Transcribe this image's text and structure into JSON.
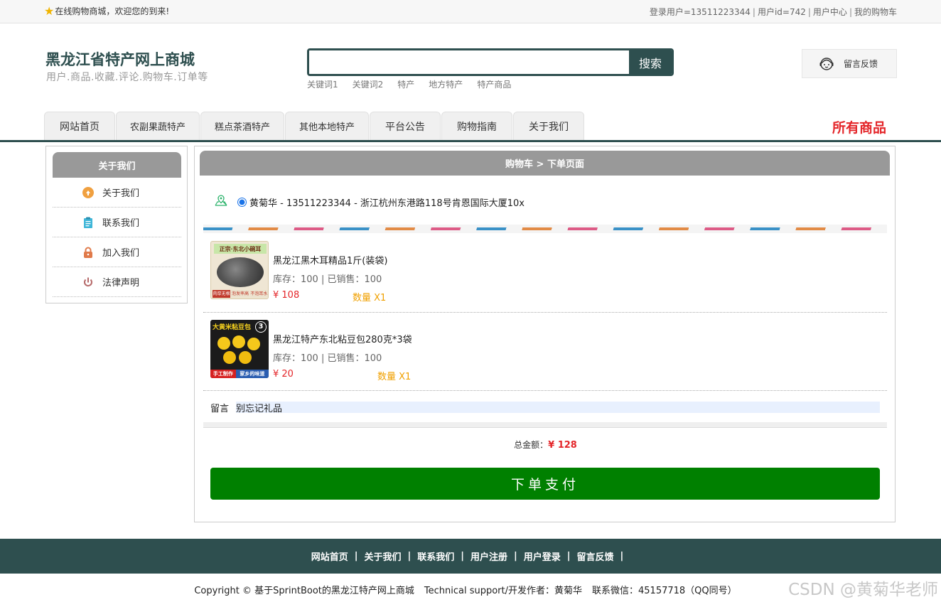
{
  "topbar": {
    "welcome": "在线购物商城，欢迎您的到来!",
    "login_user": "登录用户=13511223344",
    "user_id": "用户id=742",
    "user_center": "用户中心",
    "my_cart": "我的购物车"
  },
  "header": {
    "title": "黑龙江省特产网上商城",
    "subtitle": "用户.商品.收藏.评论.购物车.订单等",
    "search_button": "搜索",
    "search_value": "",
    "hotwords": [
      "关键词1",
      "关键词2",
      "特产",
      "地方特产",
      "特产商品"
    ],
    "feedback": "留言反馈"
  },
  "nav": {
    "tabs": [
      "网站首页",
      "农副果蔬特产",
      "糕点茶酒特产",
      "其他本地特产",
      "平台公告",
      "购物指南",
      "关于我们"
    ],
    "all_goods": "所有商品"
  },
  "sidebar": {
    "title": "关于我们",
    "items": [
      {
        "label": "关于我们",
        "icon": "about-icon",
        "color": "#f0a040"
      },
      {
        "label": "联系我们",
        "icon": "clipboard-icon",
        "color": "#3fb6d8"
      },
      {
        "label": "加入我们",
        "icon": "lock-icon",
        "color": "#e07a4a"
      },
      {
        "label": "法律声明",
        "icon": "power-icon",
        "color": "#b66a6a"
      }
    ]
  },
  "order": {
    "breadcrumb": "购物车 > 下单页面",
    "address": "黄菊华 - 13511223344 - 浙江杭州东港路118号肯恩国际大厦10x",
    "items": [
      {
        "name": "黑龙江黑木耳精品1斤(装袋)",
        "stock": "库存：100 | 已销售：100",
        "price": "¥ 108",
        "qty": "数量 X1",
        "thumb_banner": "正宗·东北小碗耳",
        "thumb_tags": [
          "肉厚无根",
          "泡发率高",
          "不泡耳水"
        ]
      },
      {
        "name": "黑龙江特产东北粘豆包280克*3袋",
        "stock": "库存：100 | 已销售：100",
        "price": "¥ 20",
        "qty": "数量 X1",
        "thumb_banner": "大黄米粘豆包",
        "thumb_badge": "3",
        "thumb_tags": [
          "手工制作",
          "家乡的味道"
        ]
      }
    ],
    "note_label": "留言",
    "note_value": "别忘记礼品",
    "total_label": "总金额：",
    "total_amount": "¥ 128",
    "pay_button": "下单支付"
  },
  "footer": {
    "links": [
      "网站首页",
      "关于我们",
      "联系我们",
      "用户注册",
      "用户登录",
      "留言反馈"
    ],
    "copyright": "Copyright © 基于SprintBoot的黑龙江特产网上商城",
    "support": "Technical support/开发作者：黄菊华",
    "contact": "联系微信：45157718（QQ同号）",
    "watermark": "CSDN @黄菊华老师"
  },
  "colors": {
    "brand": "#2e4f4f",
    "price": "#e4262a",
    "qty": "#f0a000",
    "pay": "#008000"
  }
}
